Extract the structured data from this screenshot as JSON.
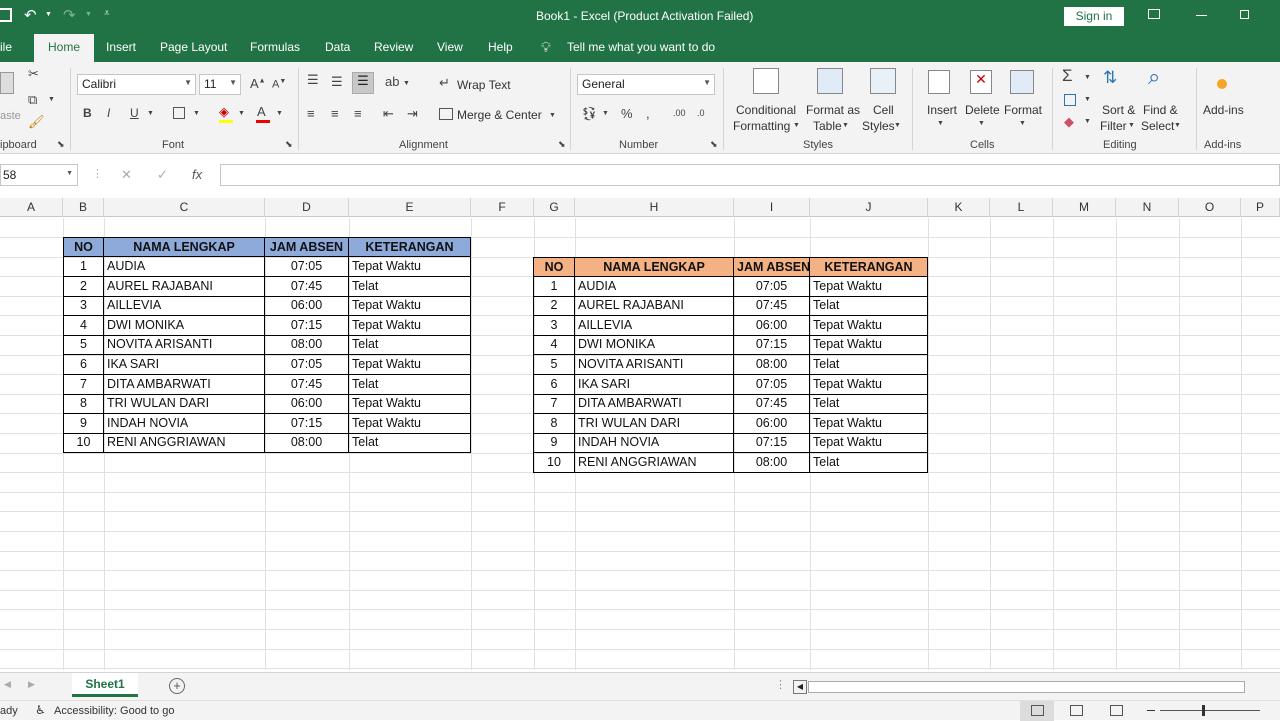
{
  "titlebar": {
    "title": "Book1  -  Excel (Product Activation Failed)",
    "signin": "Sign in"
  },
  "tabs": [
    "ile",
    "Home",
    "Insert",
    "Page Layout",
    "Formulas",
    "Data",
    "Review",
    "View",
    "Help"
  ],
  "tell_me": "Tell me what you want to do",
  "ribbon": {
    "clipboard_label": "ipboard",
    "clipboard_paste": "aste",
    "font": {
      "name": "Calibri",
      "size": "11",
      "label": "Font"
    },
    "alignment": {
      "wrap": "Wrap Text",
      "merge": "Merge & Center",
      "label": "Alignment"
    },
    "number": {
      "format": "General",
      "label": "Number"
    },
    "styles": {
      "cond1": "Conditional",
      "cond2": "Formatting",
      "fmt1": "Format as",
      "fmt2": "Table",
      "cell1": "Cell",
      "cell2": "Styles",
      "label": "Styles"
    },
    "cells": {
      "insert": "Insert",
      "delete": "Delete",
      "format": "Format",
      "label": "Cells"
    },
    "editing": {
      "sort1": "Sort &",
      "sort2": "Filter",
      "find1": "Find &",
      "find2": "Select",
      "label": "Editing"
    },
    "addins": {
      "btn": "Add-ins",
      "label": "Add-ins"
    }
  },
  "formula_bar": {
    "name_box": "58",
    "fx": "fx",
    "value": ""
  },
  "columns": [
    "A",
    "B",
    "C",
    "D",
    "E",
    "F",
    "G",
    "H",
    "I",
    "J",
    "K",
    "L",
    "M",
    "N",
    "O",
    "P"
  ],
  "table1": {
    "headers": [
      "NO",
      "NAMA LENGKAP",
      "JAM ABSEN",
      "KETERANGAN"
    ],
    "rows": [
      [
        "1",
        "AUDIA",
        "07:05",
        "Tepat Waktu"
      ],
      [
        "2",
        "AUREL RAJABANI",
        "07:45",
        "Telat"
      ],
      [
        "3",
        "AILLEVIA",
        "06:00",
        "Tepat Waktu"
      ],
      [
        "4",
        "DWI MONIKA",
        "07:15",
        "Tepat Waktu"
      ],
      [
        "5",
        "NOVITA ARISANTI",
        "08:00",
        "Telat"
      ],
      [
        "6",
        "IKA SARI",
        "07:05",
        "Tepat Waktu"
      ],
      [
        "7",
        "DITA AMBARWATI",
        "07:45",
        "Telat"
      ],
      [
        "8",
        "TRI WULAN DARI",
        "06:00",
        "Tepat Waktu"
      ],
      [
        "9",
        "INDAH NOVIA",
        "07:15",
        "Tepat Waktu"
      ],
      [
        "10",
        "RENI ANGGRIAWAN",
        "08:00",
        "Telat"
      ]
    ],
    "header_color": "#8eaadb"
  },
  "table2": {
    "headers": [
      "NO",
      "NAMA LENGKAP",
      "JAM ABSEN",
      "KETERANGAN"
    ],
    "rows": [
      [
        "1",
        "AUDIA",
        "07:05",
        "Tepat Waktu"
      ],
      [
        "2",
        "AUREL RAJABANI",
        "07:45",
        "Telat"
      ],
      [
        "3",
        "AILLEVIA",
        "06:00",
        "Tepat Waktu"
      ],
      [
        "4",
        "DWI MONIKA",
        "07:15",
        "Tepat Waktu"
      ],
      [
        "5",
        "NOVITA ARISANTI",
        "08:00",
        "Telat"
      ],
      [
        "6",
        "IKA SARI",
        "07:05",
        "Tepat Waktu"
      ],
      [
        "7",
        "DITA AMBARWATI",
        "07:45",
        "Telat"
      ],
      [
        "8",
        "TRI WULAN DARI",
        "06:00",
        "Tepat Waktu"
      ],
      [
        "9",
        "INDAH NOVIA",
        "07:15",
        "Tepat Waktu"
      ],
      [
        "10",
        "RENI ANGGRIAWAN",
        "08:00",
        "Telat"
      ]
    ],
    "header_color": "#f4b183"
  },
  "sheet_tab": "Sheet1",
  "status": {
    "ready": "ady",
    "accessibility": "Accessibility: Good to go"
  },
  "accent_color": "#217346"
}
